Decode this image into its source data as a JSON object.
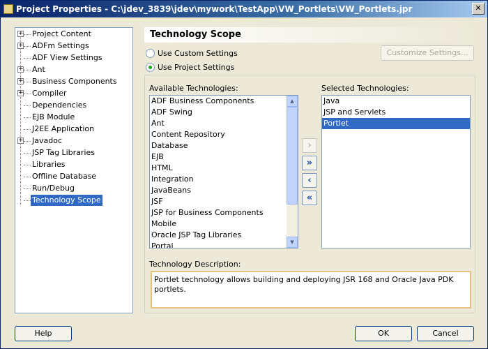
{
  "window": {
    "title": "Project Properties - C:\\jdev_3839\\jdev\\mywork\\TestApp\\VW_Portlets\\VW_Portlets.jpr",
    "close": "✕"
  },
  "tree": [
    {
      "label": "Project Content",
      "expandable": true
    },
    {
      "label": "ADFm Settings",
      "expandable": true
    },
    {
      "label": "ADF View Settings",
      "expandable": false
    },
    {
      "label": "Ant",
      "expandable": true
    },
    {
      "label": "Business Components",
      "expandable": true
    },
    {
      "label": "Compiler",
      "expandable": true
    },
    {
      "label": "Dependencies",
      "expandable": false
    },
    {
      "label": "EJB Module",
      "expandable": false
    },
    {
      "label": "J2EE Application",
      "expandable": false
    },
    {
      "label": "Javadoc",
      "expandable": true
    },
    {
      "label": "JSP Tag Libraries",
      "expandable": false
    },
    {
      "label": "Libraries",
      "expandable": false
    },
    {
      "label": "Offline Database",
      "expandable": false
    },
    {
      "label": "Run/Debug",
      "expandable": false
    },
    {
      "label": "Technology Scope",
      "expandable": false,
      "selected": true
    }
  ],
  "panel": {
    "title": "Technology Scope",
    "radio_custom": "Use Custom Settings",
    "radio_project": "Use Project Settings",
    "selected_radio": "project",
    "customize_button": "Customize Settings...",
    "available_label": "Available Technologies:",
    "selected_label": "Selected Technologies:",
    "available": [
      "ADF Business Components",
      "ADF Swing",
      "Ant",
      "Content Repository",
      "Database",
      "EJB",
      "HTML",
      "Integration",
      "JavaBeans",
      "JSF",
      "JSP for Business Components",
      "Mobile",
      "Oracle JSP Tag Libraries",
      "Portal"
    ],
    "selected": [
      "Java",
      "JSP and Servlets",
      "Portlet"
    ],
    "selected_highlight": 2,
    "move_buttons": {
      "add": "›",
      "add_all": "»",
      "remove": "‹",
      "remove_all": "«"
    },
    "description_label": "Technology Description:",
    "description": "Portlet technology allows building and deploying JSR 168 and Oracle  Java PDK portlets."
  },
  "buttons": {
    "help": "Help",
    "ok": "OK",
    "cancel": "Cancel"
  },
  "colors": {
    "selection": "#316ac5",
    "title_bar": "#0a246a",
    "radio_dot": "#21a121"
  }
}
